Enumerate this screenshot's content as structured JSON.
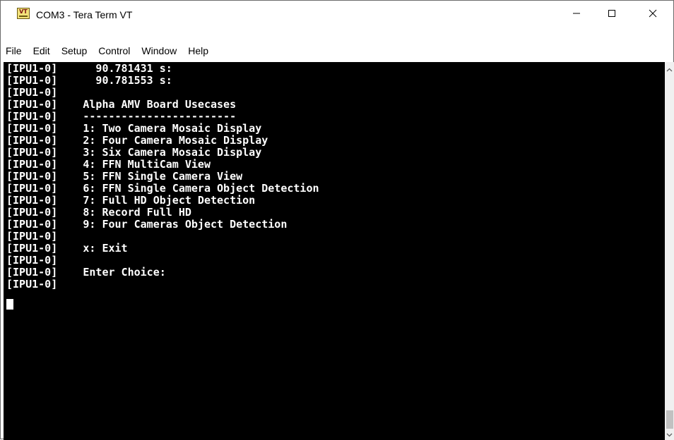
{
  "window": {
    "title": "COM3 - Tera Term VT",
    "icon": "teraterm-app-icon",
    "icon_text": "VT",
    "controls": [
      "minimize-icon",
      "maximize-icon",
      "close-icon"
    ]
  },
  "menu": {
    "items": [
      {
        "label": "File"
      },
      {
        "label": "Edit"
      },
      {
        "label": "Setup"
      },
      {
        "label": "Control"
      },
      {
        "label": "Window"
      },
      {
        "label": "Help"
      }
    ]
  },
  "terminal": {
    "background": "#000000",
    "foreground": "#ffffff",
    "lines": [
      "[IPU1-0]      90.781431 s:",
      "[IPU1-0]      90.781553 s:",
      "[IPU1-0]",
      "[IPU1-0]    Alpha AMV Board Usecases",
      "[IPU1-0]    ------------------------",
      "[IPU1-0]    1: Two Camera Mosaic Display",
      "[IPU1-0]    2: Four Camera Mosaic Display",
      "[IPU1-0]    3: Six Camera Mosaic Display",
      "[IPU1-0]    4: FFN MultiCam View",
      "[IPU1-0]    5: FFN Single Camera View",
      "[IPU1-0]    6: FFN Single Camera Object Detection",
      "[IPU1-0]    7: Full HD Object Detection",
      "[IPU1-0]    8: Record Full HD",
      "[IPU1-0]    9: Four Cameras Object Detection",
      "[IPU1-0]",
      "[IPU1-0]    x: Exit",
      "[IPU1-0]",
      "[IPU1-0]    Enter Choice:",
      "[IPU1-0]"
    ]
  },
  "scrollbar": {
    "up_icon": "scroll-up-arrow-icon",
    "down_icon": "scroll-down-arrow-icon",
    "position": 0.98
  }
}
